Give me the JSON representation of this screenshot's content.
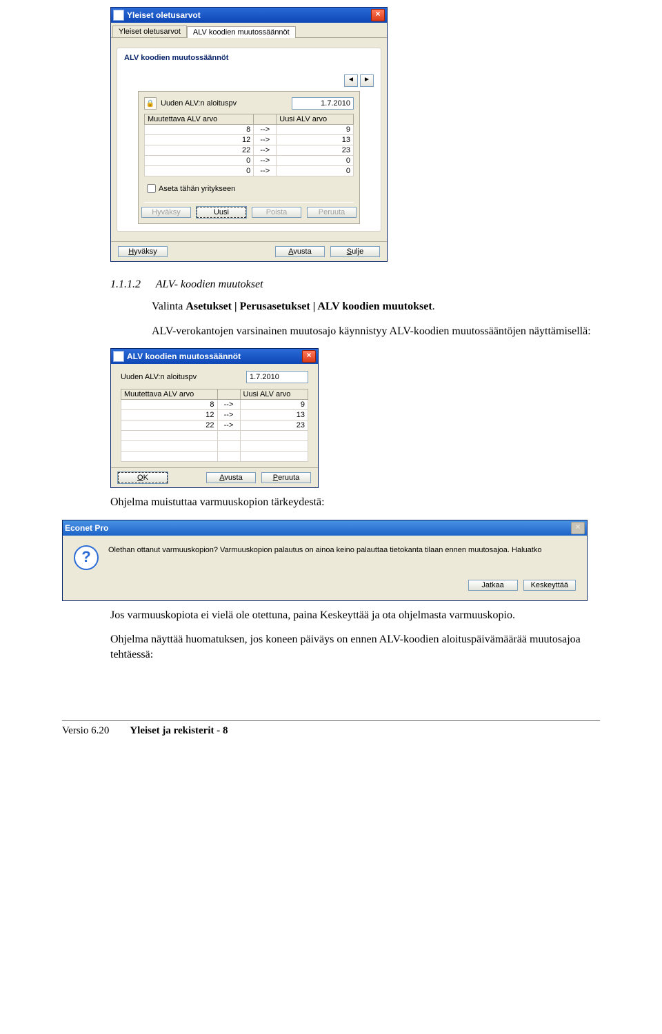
{
  "screenshot1": {
    "title": "Yleiset oletusarvot",
    "tabs": [
      "Yleiset oletusarvot",
      "ALV koodien muutossäännöt"
    ],
    "group_title": "ALV koodien muutossäännöt",
    "date_label": "Uuden ALV:n aloituspv",
    "date_value": "1.7.2010",
    "col_old": "Muutettava ALV arvo",
    "col_new": "Uusi ALV arvo",
    "rows": [
      {
        "old": "8",
        "new": "9"
      },
      {
        "old": "12",
        "new": "13"
      },
      {
        "old": "22",
        "new": "23"
      },
      {
        "old": "0",
        "new": "0"
      },
      {
        "old": "0",
        "new": "0"
      }
    ],
    "checkbox": "Aseta tähän yritykseen",
    "inner_btns": {
      "hyvaksy": "Hyväksy",
      "uusi": "Uusi",
      "poista": "Poista",
      "peruuta": "Peruuta"
    },
    "footer_btns": {
      "hyvaksy": "Hyväksy",
      "avusta": "Avusta",
      "sulje": "Sulje"
    }
  },
  "doc": {
    "section": "1.1.1.2",
    "section_title": "ALV- koodien muutokset",
    "line1a": "Valinta ",
    "line1b": "Asetukset | Perusasetukset | ALV koodien muutokset",
    "line1c": ".",
    "line2": "ALV-verokantojen varsinainen muutosajo käynnistyy ALV-koodien muutossääntöjen näyttämisellä:",
    "line3": "Ohjelma muistuttaa varmuuskopion tärkeydestä:",
    "line4": "Jos varmuuskopiota ei vielä ole otettuna, paina Keskeyttää ja ota ohjelmasta varmuuskopio.",
    "line5": "Ohjelma näyttää huomatuksen, jos koneen päiväys on ennen ALV-koodien aloituspäivämäärää muutosajoa tehtäessä:",
    "footer_left": "Versio 6.20",
    "footer_right": "Yleiset ja rekisterit - 8"
  },
  "screenshot2": {
    "title": "ALV koodien muutossäännöt",
    "date_label": "Uuden ALV:n aloituspv",
    "date_value": "1.7.2010",
    "col_old": "Muutettava ALV arvo",
    "col_new": "Uusi ALV arvo",
    "rows": [
      {
        "old": "8",
        "new": "9"
      },
      {
        "old": "12",
        "new": "13"
      },
      {
        "old": "22",
        "new": "23"
      }
    ],
    "btns": {
      "ok": "OK",
      "avusta": "Avusta",
      "peruuta": "Peruuta"
    }
  },
  "msgbox": {
    "title": "Econet Pro",
    "text": "Olethan ottanut varmuuskopion? Varmuuskopion palautus on ainoa keino palauttaa tietokanta tilaan ennen muutosajoa. Haluatko",
    "btn_continue": "Jatkaa",
    "btn_cancel": "Keskeyttää"
  }
}
